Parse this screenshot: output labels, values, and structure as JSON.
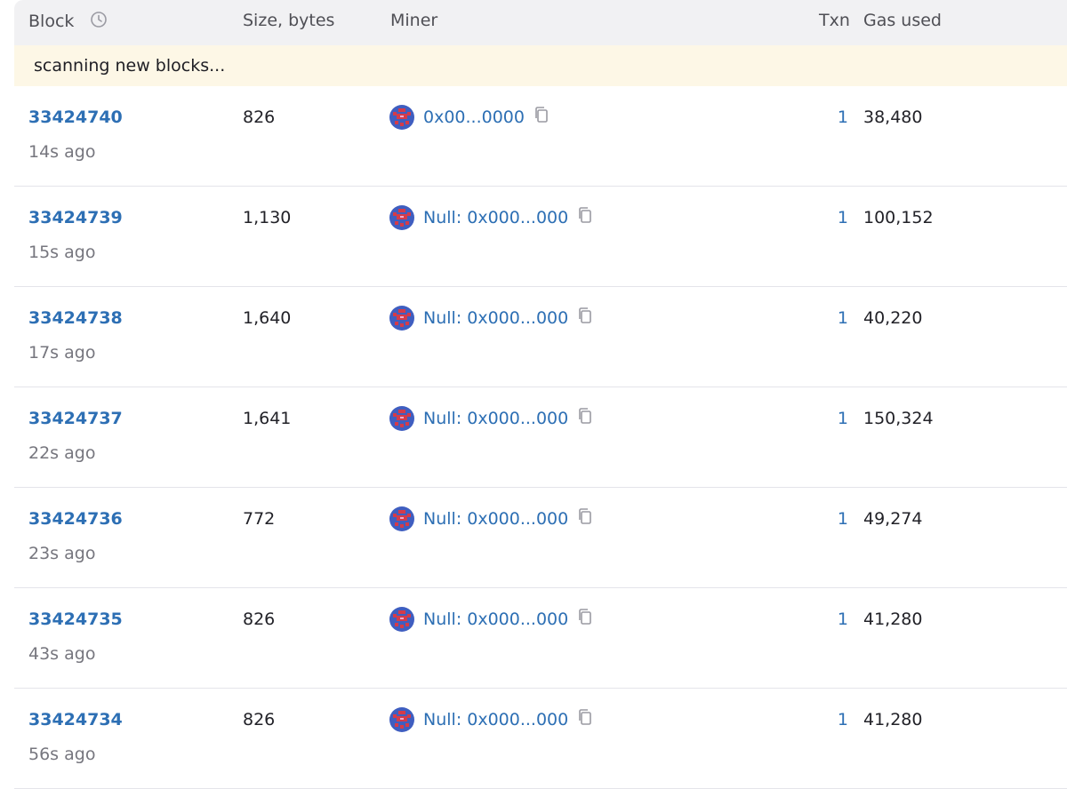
{
  "header": {
    "block": "Block",
    "size": "Size, bytes",
    "miner": "Miner",
    "txn": "Txn",
    "gas": "Gas used"
  },
  "banner": "scanning new blocks...",
  "colors": {
    "link": "#2d6fb4",
    "header_bg": "#f1f1f3",
    "banner_bg": "#fdf7e6",
    "muted": "#76767e"
  },
  "icons": {
    "header": "clock-icon",
    "copy": "copy-icon",
    "avatar": "identicon-avatar"
  },
  "rows": [
    {
      "block": "33424740",
      "time": "14s ago",
      "size": "826",
      "miner": "0x00...0000",
      "txn": "1",
      "gas": "38,480"
    },
    {
      "block": "33424739",
      "time": "15s ago",
      "size": "1,130",
      "miner": "Null: 0x000...000",
      "txn": "1",
      "gas": "100,152"
    },
    {
      "block": "33424738",
      "time": "17s ago",
      "size": "1,640",
      "miner": "Null: 0x000...000",
      "txn": "1",
      "gas": "40,220"
    },
    {
      "block": "33424737",
      "time": "22s ago",
      "size": "1,641",
      "miner": "Null: 0x000...000",
      "txn": "1",
      "gas": "150,324"
    },
    {
      "block": "33424736",
      "time": "23s ago",
      "size": "772",
      "miner": "Null: 0x000...000",
      "txn": "1",
      "gas": "49,274"
    },
    {
      "block": "33424735",
      "time": "43s ago",
      "size": "826",
      "miner": "Null: 0x000...000",
      "txn": "1",
      "gas": "41,280"
    },
    {
      "block": "33424734",
      "time": "56s ago",
      "size": "826",
      "miner": "Null: 0x000...000",
      "txn": "1",
      "gas": "41,280"
    }
  ]
}
